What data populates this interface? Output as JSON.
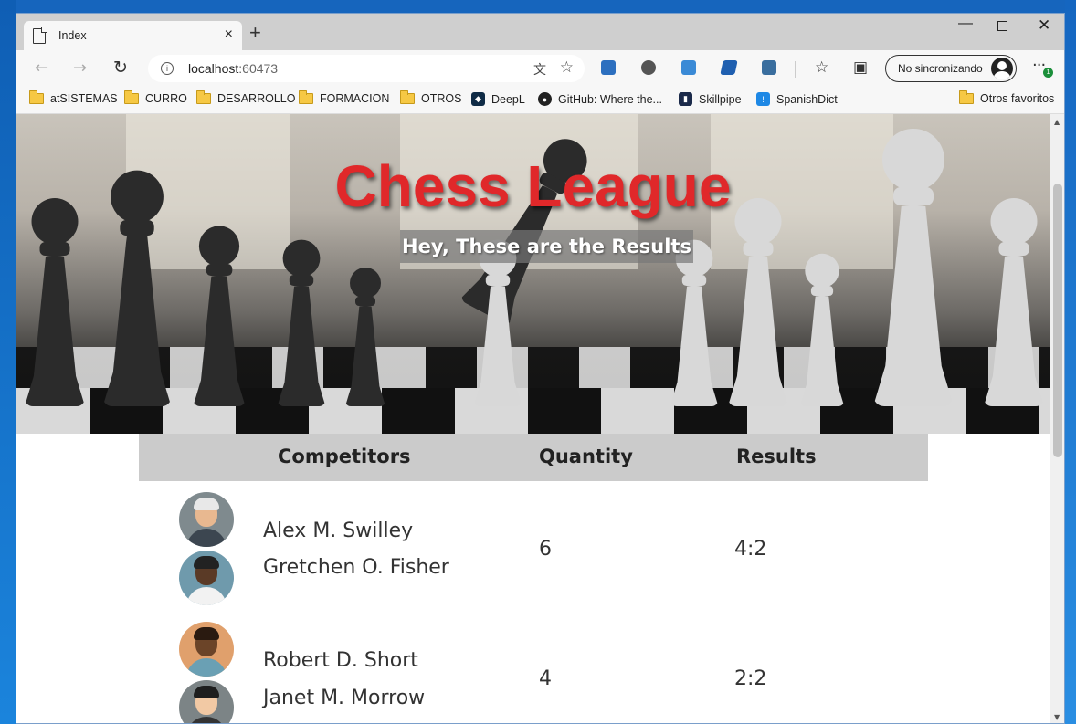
{
  "browser": {
    "tab_title": "Index",
    "tab_close": "×",
    "new_tab": "+",
    "url_host": "localhost",
    "url_port": ":60473",
    "profile_label": "No sincronizando",
    "badge": "1"
  },
  "bookmarks": [
    {
      "label": "atSISTEMAS",
      "icon": "folder-icon"
    },
    {
      "label": "CURRO",
      "icon": "folder-icon"
    },
    {
      "label": "DESARROLLO",
      "icon": "folder-icon"
    },
    {
      "label": "FORMACION",
      "icon": "folder-icon"
    },
    {
      "label": "OTROS",
      "icon": "folder-icon"
    },
    {
      "label": "DeepL",
      "icon": "deepl-icon"
    },
    {
      "label": "GitHub: Where the...",
      "icon": "github-icon"
    },
    {
      "label": "Skillpipe",
      "icon": "skillpipe-icon"
    },
    {
      "label": "SpanishDict",
      "icon": "spanishdict-icon"
    }
  ],
  "bookmarks_other": "Otros favoritos",
  "hero": {
    "title": "Chess League",
    "subtitle": "Hey, These are the Results"
  },
  "table": {
    "headers": {
      "competitors": "Competitors",
      "quantity": "Quantity",
      "results": "Results"
    },
    "rows": [
      {
        "player1": "Alex M. Swilley",
        "player2": "Gretchen O. Fisher",
        "quantity": "6",
        "result": "4:2"
      },
      {
        "player1": "Robert D. Short",
        "player2": "Janet M. Morrow",
        "quantity": "4",
        "result": "2:2"
      }
    ]
  },
  "colors": {
    "title": "#e0282a",
    "header_bg": "#cbcbcb"
  }
}
